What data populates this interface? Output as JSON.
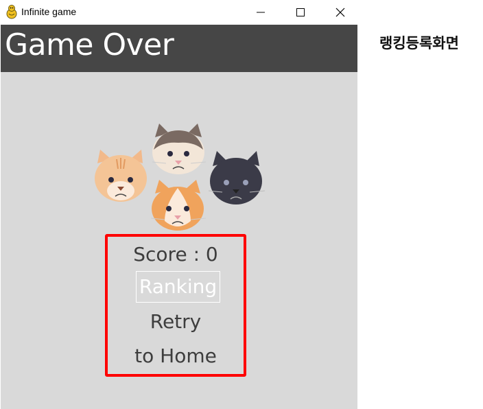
{
  "window": {
    "title": "Infinite game",
    "controls": [
      "minimize",
      "maximize",
      "close"
    ]
  },
  "header": {
    "title": "Game Over"
  },
  "image": {
    "description_icons": [
      "cat-face-icon",
      "cat-face-icon",
      "cat-face-icon",
      "cat-face-icon"
    ]
  },
  "menu": {
    "score": "Score : 0",
    "ranking": "Ranking",
    "retry": "Retry",
    "home": "to Home"
  },
  "annotation": {
    "text": "랭킹등록화면"
  },
  "colors": {
    "header_bg": "#464646",
    "game_bg": "#d9d9d9",
    "highlight": "#ff0000"
  }
}
